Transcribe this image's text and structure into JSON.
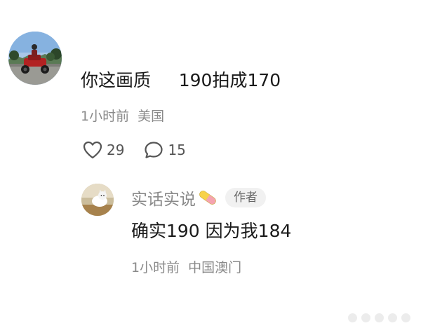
{
  "main_comment": {
    "text": "你这画质     190拍成170",
    "time": "1小时前",
    "location": "美国",
    "likes": "29",
    "replies": "15",
    "like_icon": "heart-icon",
    "reply_icon": "comment-bubble-icon"
  },
  "reply": {
    "username": "实话实说",
    "username_emoji": "pill-icon",
    "badge": "作者",
    "text": "确实190 因为我184",
    "time": "1小时前",
    "location": "中国澳门"
  },
  "colors": {
    "primary_text": "#1a1a1a",
    "secondary_text": "#8a8a8a",
    "badge_bg": "#f1f1f1"
  }
}
